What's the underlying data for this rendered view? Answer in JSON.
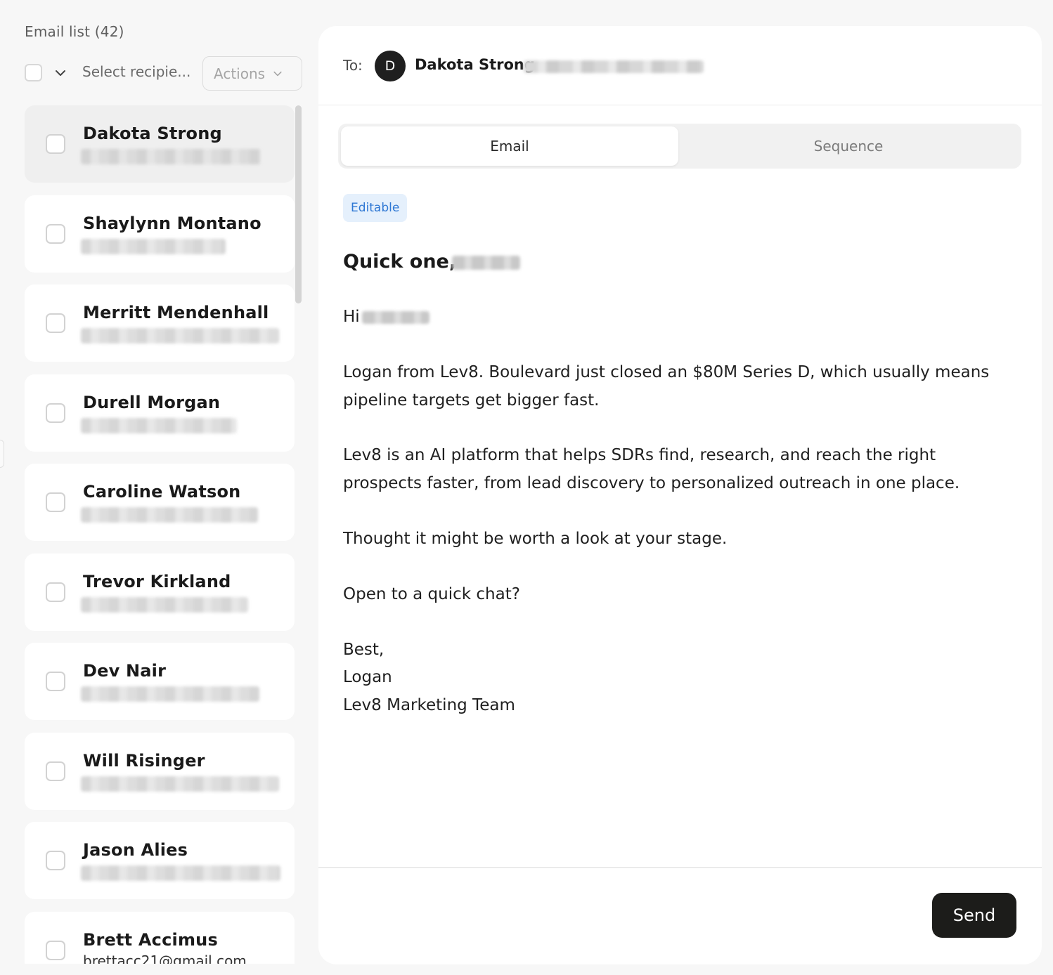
{
  "sidebar": {
    "title": "Email list (42)",
    "select_label": "Select recipie...",
    "actions_label": "Actions",
    "recipients": [
      {
        "name": "Dakota Strong",
        "email": ""
      },
      {
        "name": "Shaylynn Montano",
        "email": ""
      },
      {
        "name": "Merritt Mendenhall",
        "email": ""
      },
      {
        "name": "Durell Morgan",
        "email": ""
      },
      {
        "name": "Caroline Watson",
        "email": ""
      },
      {
        "name": "Trevor Kirkland",
        "email": ""
      },
      {
        "name": "Dev Nair",
        "email": ""
      },
      {
        "name": "Will Risinger",
        "email": ""
      },
      {
        "name": "Jason Alies",
        "email": ""
      },
      {
        "name": "Brett Accimus",
        "email": "brettacc21@gmail.com"
      }
    ]
  },
  "composer": {
    "to_label": "To:",
    "avatar_initial": "D",
    "to_name": "Dakota Strong",
    "tabs": {
      "email": "Email",
      "sequence": "Sequence"
    },
    "badge": "Editable",
    "subject_prefix": "Quick one,",
    "greeting": "Hi",
    "paragraph_1": "Logan from Lev8. Boulevard just closed an $80M Series D, which usually means pipeline targets get bigger fast.",
    "paragraph_2": "Lev8 is an AI platform that helps SDRs find, research, and reach the right prospects faster, from lead discovery to personalized outreach in one place.",
    "paragraph_3": "Thought it might be worth a look at your stage.",
    "paragraph_4": "Open to a quick chat?",
    "signoff": "Best,",
    "signature_name": "Logan",
    "signature_team": "Lev8 Marketing Team",
    "send_label": "Send"
  }
}
